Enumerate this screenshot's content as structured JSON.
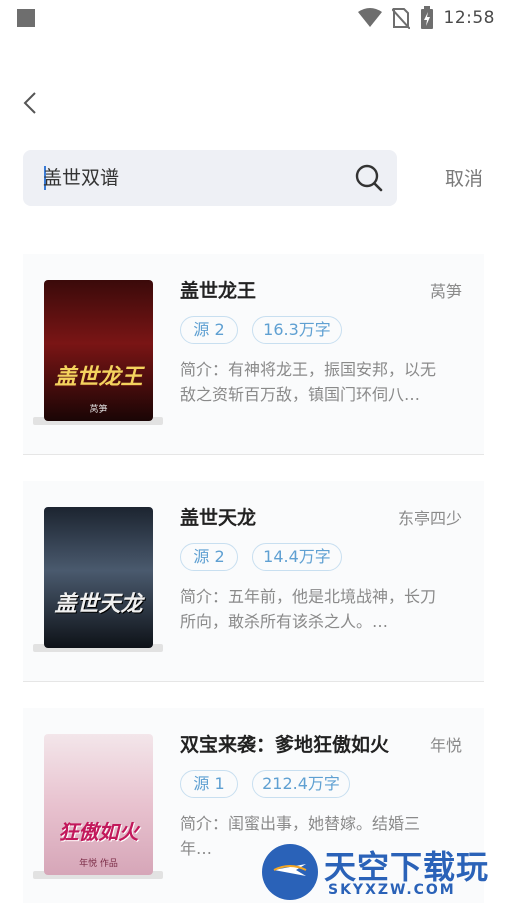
{
  "status_bar": {
    "time": "12:58",
    "icons": [
      "notification-square-icon",
      "wifi-icon",
      "no-sim-icon",
      "battery-charging-icon"
    ]
  },
  "header": {
    "back_icon": "chevron-left-icon"
  },
  "search": {
    "value": "盖世双谱",
    "search_icon": "search-icon",
    "cancel_label": "取消"
  },
  "books": [
    {
      "title": "盖世龙王",
      "author": "莴笋",
      "source": "源 2",
      "words": "16.3万字",
      "desc": "简介：有神将龙王，振国安邦，以无敌之资斩百万敌，镇国门环伺八…",
      "cover_title": "盖世龙王",
      "cover_author": "莴笋"
    },
    {
      "title": "盖世天龙",
      "author": "东亭四少",
      "source": "源 2",
      "words": "14.4万字",
      "desc": "简介：五年前，他是北境战神，长刀所向，敢杀所有该杀之人。…",
      "cover_title": "盖世天龙",
      "cover_author": ""
    },
    {
      "title": "双宝来袭：爹地狂傲如火",
      "author": "年悦",
      "source": "源 1",
      "words": "212.4万字",
      "desc": "简介：闺蜜出事，她替嫁。结婚三年…",
      "cover_title": "狂傲如火",
      "cover_author": "年悦 作品"
    }
  ],
  "watermark": {
    "cn": "天空下载玩",
    "en": "SKYXZW.COM"
  }
}
